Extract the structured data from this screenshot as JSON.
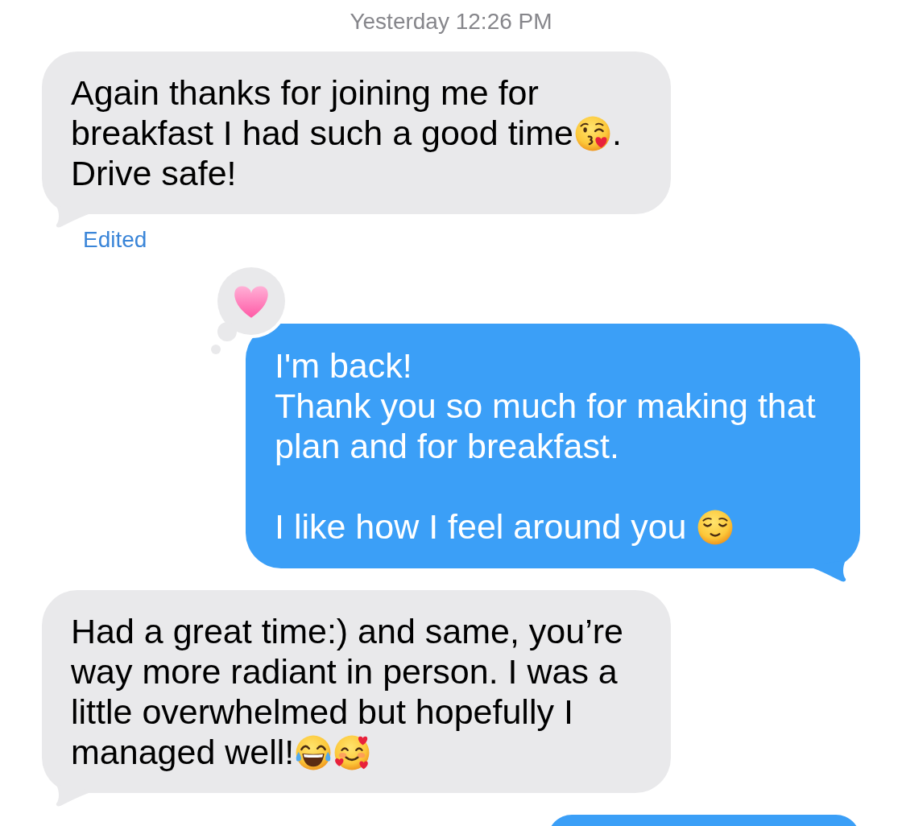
{
  "timestamp": "Yesterday 12:26 PM",
  "messages": [
    {
      "kind": "received",
      "tail": true,
      "edited_label": "Edited",
      "paragraphs": [
        {
          "lines": [
            [
              {
                "kind": "text",
                "text": "Again thanks for joining me for breakfast I had such a good time"
              },
              {
                "kind": "kiss"
              },
              {
                "kind": "text",
                "text": "."
              }
            ],
            [
              {
                "kind": "text",
                "text": "Drive safe!"
              }
            ]
          ]
        }
      ]
    },
    {
      "kind": "sent",
      "tail": true,
      "tapback": {
        "kind": "heart"
      },
      "paragraphs": [
        {
          "lines": [
            [
              {
                "kind": "text",
                "text": "I'm back!"
              }
            ],
            [
              {
                "kind": "text",
                "text": "Thank you so much for making that plan and for breakfast."
              }
            ]
          ]
        },
        {
          "lines": [
            [
              {
                "kind": "text",
                "text": "I like how I feel around you "
              },
              {
                "kind": "relieved"
              }
            ]
          ]
        }
      ]
    },
    {
      "kind": "received",
      "tail": true,
      "paragraphs": [
        {
          "lines": [
            [
              {
                "kind": "text",
                "text": "Had a great time:) and same, you’re way more radiant in person. I was a little overwhelmed but hopefully I"
              }
            ],
            [
              {
                "kind": "text",
                "text": "managed well!"
              },
              {
                "kind": "laughing"
              },
              {
                "kind": "adoring"
              }
            ]
          ]
        }
      ]
    },
    {
      "kind": "sent",
      "tail": false
    }
  ]
}
